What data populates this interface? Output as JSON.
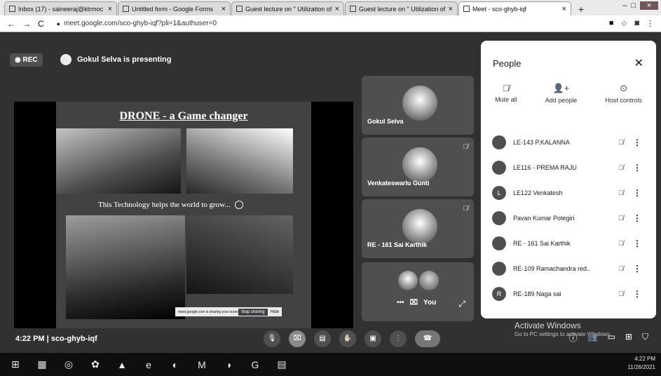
{
  "browser": {
    "tabs": [
      {
        "label": "Inbox (17) - saineeraj@ktrmoc",
        "active": false
      },
      {
        "label": "Untitled form - Google Forms",
        "active": false
      },
      {
        "label": "Guest lecture on \" Utilization of",
        "active": false
      },
      {
        "label": "Guest lecture on \" Utilization of",
        "active": false
      },
      {
        "label": "Meet - sco-ghyb-iqf",
        "active": true
      }
    ],
    "url": "meet.google.com/sco-ghyb-iqf?pli=1&authuser=0",
    "new_tab": "+",
    "back": "←",
    "forward": "→",
    "reload": "C"
  },
  "meet": {
    "rec_label": "REC",
    "presenting_text": "Gokul Selva is presenting",
    "slide": {
      "title": "DRONE - a Game changer",
      "caption": "This Technology helps the world to grow...",
      "notice_text": "meet.google.com is sharing your screen",
      "notice_stop": "Stop sharing",
      "notice_hide": "Hide"
    },
    "tiles": [
      {
        "name": "Gokul Selva"
      },
      {
        "name": "Venkateswarlu Gunti"
      },
      {
        "name": "RE - 161 Sai Karthik"
      },
      {
        "name": "You"
      }
    ],
    "clock": "4:22 PM",
    "meeting_code": "sco-ghyb-iqf",
    "watermark": "Activate Windows",
    "watermark_sub": "Go to PC settings to activate Windows."
  },
  "people_panel": {
    "title": "People",
    "actions": [
      {
        "label": "Mute all",
        "icon": "mic-off-icon"
      },
      {
        "label": "Add people",
        "icon": "add-person-icon"
      },
      {
        "label": "Host controls",
        "icon": "toggle-icon"
      }
    ],
    "participants": [
      {
        "name": "LE-143 P.KALANNA",
        "initial": ""
      },
      {
        "name": "LE116 - PREMA RAJU",
        "initial": ""
      },
      {
        "name": "LE122 Venkatesh",
        "initial": "L"
      },
      {
        "name": "Pavan Kumar Potegiri",
        "initial": ""
      },
      {
        "name": "RE - 161 Sai Karthik",
        "initial": ""
      },
      {
        "name": "RE-109 Ramachandra red..",
        "initial": ""
      },
      {
        "name": "RE-189 Naga sai",
        "initial": "R"
      }
    ]
  },
  "taskbar": {
    "time": "4:22 PM",
    "date": "11/26/2021"
  }
}
